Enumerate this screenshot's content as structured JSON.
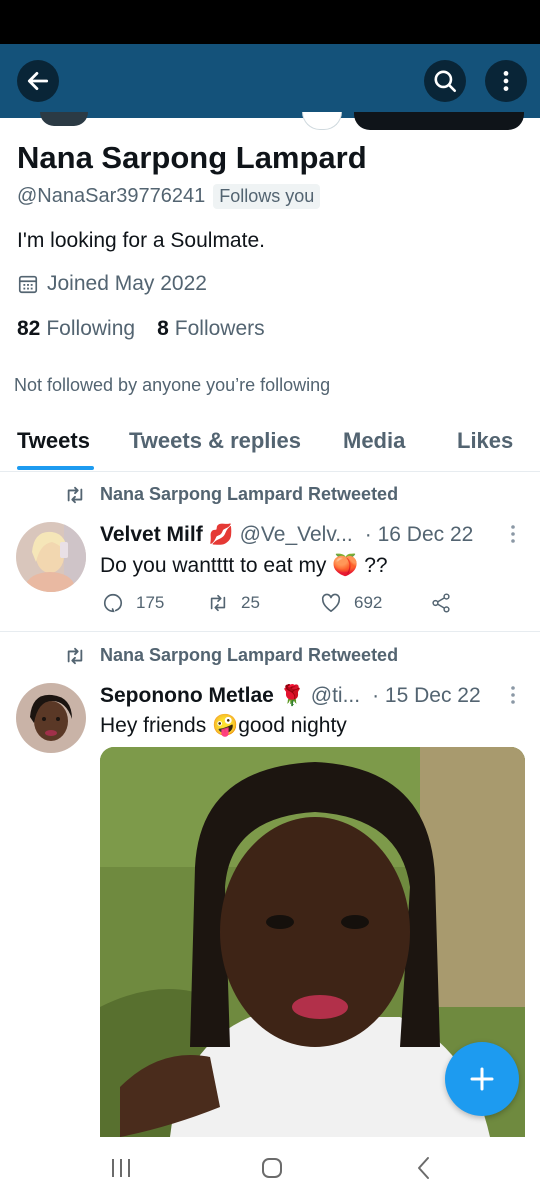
{
  "top_bar": {
    "back_icon": "arrow-left-icon",
    "search_icon": "search-icon",
    "more_icon": "more-vertical-icon"
  },
  "profile": {
    "name": "Nana Sarpong Lampard",
    "handle": "@NanaSar39776241",
    "follows_you": "Follows you",
    "bio": "I'm looking for a Soulmate.",
    "joined": "Joined May 2022",
    "following_count": "82",
    "following_label": "Following",
    "followers_count": "8",
    "followers_label": "Followers",
    "not_followed": "Not followed by anyone you’re following"
  },
  "tabs": [
    {
      "label": "Tweets",
      "active": true
    },
    {
      "label": "Tweets & replies",
      "active": false
    },
    {
      "label": "Media",
      "active": false
    },
    {
      "label": "Likes",
      "active": false
    }
  ],
  "tweets": [
    {
      "retweeted_by": "Nana Sarpong Lampard Retweeted",
      "author_name": "Velvet Milf",
      "author_emoji": "💋",
      "author_handle": "@Ve_Velv...",
      "date": "· 16 Dec 22",
      "text": "Do you wantttt to eat my 🍑 ??",
      "replies": "175",
      "retweets": "25",
      "likes": "692"
    },
    {
      "retweeted_by": "Nana Sarpong Lampard Retweeted",
      "author_name": "Seponono Metlae",
      "author_emoji": "🌹",
      "author_handle": "@ti...",
      "date": "· 15 Dec 22",
      "text": "Hey friends 🤪good nighty"
    }
  ],
  "colors": {
    "accent": "#1d9bf0",
    "header": "#14527a",
    "muted": "#536471"
  }
}
